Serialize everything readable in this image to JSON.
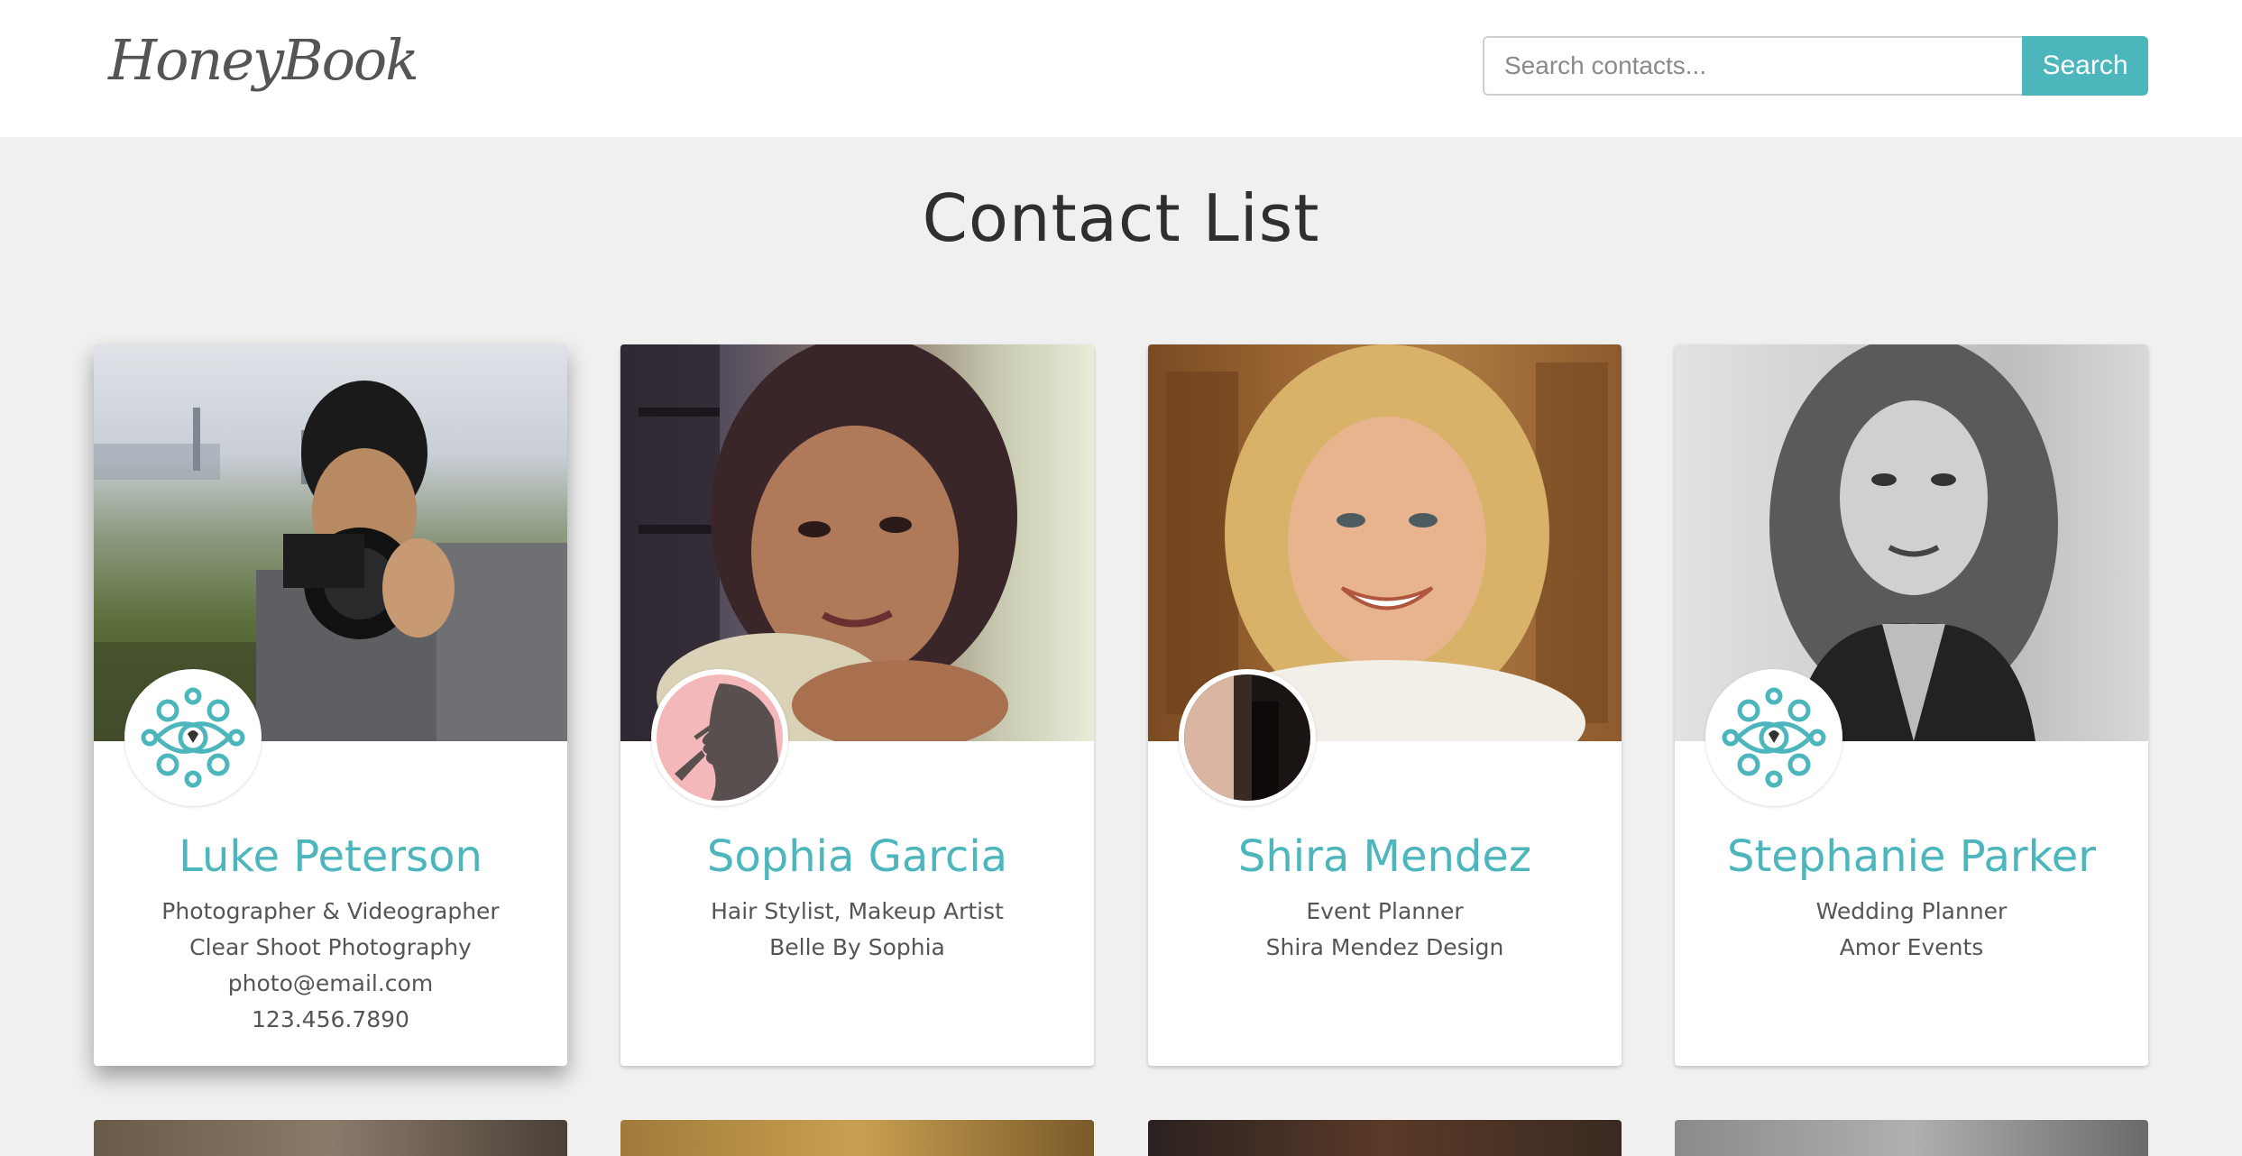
{
  "header": {
    "logo_text": "HoneyBook",
    "search_placeholder": "Search contacts...",
    "search_button_label": "Search"
  },
  "page": {
    "title": "Contact List"
  },
  "colors": {
    "accent": "#4db6bd",
    "background": "#f0f0f0",
    "title": "#2f2f2f"
  },
  "contacts": [
    {
      "name": "Luke Peterson",
      "title": "Photographer & Videographer",
      "company": "Clear Shoot Photography",
      "email": "photo@email.com",
      "phone": "123.456.7890",
      "avatar_icon": "honeybook-ornament-icon"
    },
    {
      "name": "Sophia Garcia",
      "title": "Hair Stylist, Makeup Artist",
      "company": "Belle By Sophia",
      "avatar_icon": "makeup-silhouette-icon"
    },
    {
      "name": "Shira Mendez",
      "title": "Event Planner",
      "company": "Shira Mendez Design",
      "avatar_icon": "dark-photo-icon"
    },
    {
      "name": "Stephanie Parker",
      "title": "Wedding Planner",
      "company": "Amor Events",
      "avatar_icon": "honeybook-ornament-icon"
    }
  ]
}
